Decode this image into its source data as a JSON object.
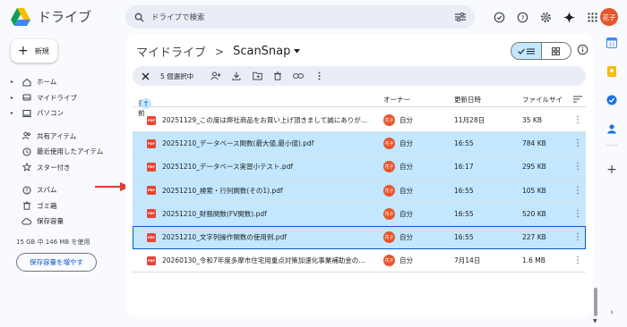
{
  "app": {
    "name": "ドライブ"
  },
  "search": {
    "placeholder": "ドライブで検索"
  },
  "account": {
    "avatar_text": "花子"
  },
  "new_button": {
    "label": "新規"
  },
  "nav": {
    "items": [
      {
        "label": "ホーム",
        "icon": "home-icon",
        "arrow": "▸"
      },
      {
        "label": "マイドライブ",
        "icon": "drive-icon",
        "arrow": "▸"
      },
      {
        "label": "パソコン",
        "icon": "computer-icon",
        "arrow": "▸"
      },
      {
        "label": "共有アイテム",
        "icon": "people-icon",
        "arrow": ""
      },
      {
        "label": "最近使用したアイテム",
        "icon": "clock-icon",
        "arrow": ""
      },
      {
        "label": "スター付き",
        "icon": "star-icon",
        "arrow": ""
      },
      {
        "label": "スパム",
        "icon": "spam-icon",
        "arrow": ""
      },
      {
        "label": "ゴミ箱",
        "icon": "trash-icon",
        "arrow": ""
      },
      {
        "label": "保存容量",
        "icon": "cloud-icon",
        "arrow": ""
      }
    ],
    "storage_text": "15 GB 中 146 MB を使用",
    "storage_button": "保存容量を増やす"
  },
  "breadcrumb": {
    "root": "マイドライブ",
    "separator": ">",
    "current": "ScanSnap"
  },
  "selection": {
    "count_label": "5 個選択中"
  },
  "table": {
    "columns": {
      "name": "名前",
      "owner": "オーナー",
      "modified": "更新日時",
      "size": "ファイルサイ"
    },
    "rows": [
      {
        "name": "20251129_この度は弊社商品をお買い上げ頂きまして誠にありがと…",
        "owner": "自分",
        "owner_avatar": "花子",
        "date": "11月28日",
        "size": "35 KB",
        "selected": false,
        "focus": false
      },
      {
        "name": "20251210_データベース関数(最大値,最小値).pdf",
        "owner": "自分",
        "owner_avatar": "花子",
        "date": "16:55",
        "size": "784 KB",
        "selected": true,
        "focus": false
      },
      {
        "name": "20251210_データベース実習小テスト.pdf",
        "owner": "自分",
        "owner_avatar": "花子",
        "date": "16:17",
        "size": "295 KB",
        "selected": true,
        "focus": false
      },
      {
        "name": "20251210_検索・行列関数(その1).pdf",
        "owner": "自分",
        "owner_avatar": "花子",
        "date": "16:55",
        "size": "105 KB",
        "selected": true,
        "focus": false
      },
      {
        "name": "20251210_財務関数(FV関数).pdf",
        "owner": "自分",
        "owner_avatar": "花子",
        "date": "16:55",
        "size": "520 KB",
        "selected": true,
        "focus": false
      },
      {
        "name": "20251210_文字列操作関数の使用例.pdf",
        "owner": "自分",
        "owner_avatar": "花子",
        "date": "16:55",
        "size": "227 KB",
        "selected": true,
        "focus": true
      },
      {
        "name": "20260130_令和7年度多摩市住宅用重点対策加速化事業補助金の…",
        "owner": "自分",
        "owner_avatar": "花子",
        "date": "7月14日",
        "size": "1.6 MB",
        "selected": false,
        "focus": false
      }
    ]
  },
  "colors": {
    "accent": "#0b57d0",
    "selected_row": "#c2e7ff",
    "avatar": "#e8552b",
    "pdf": "#ea4335",
    "annotation_arrow": "#e53935"
  }
}
